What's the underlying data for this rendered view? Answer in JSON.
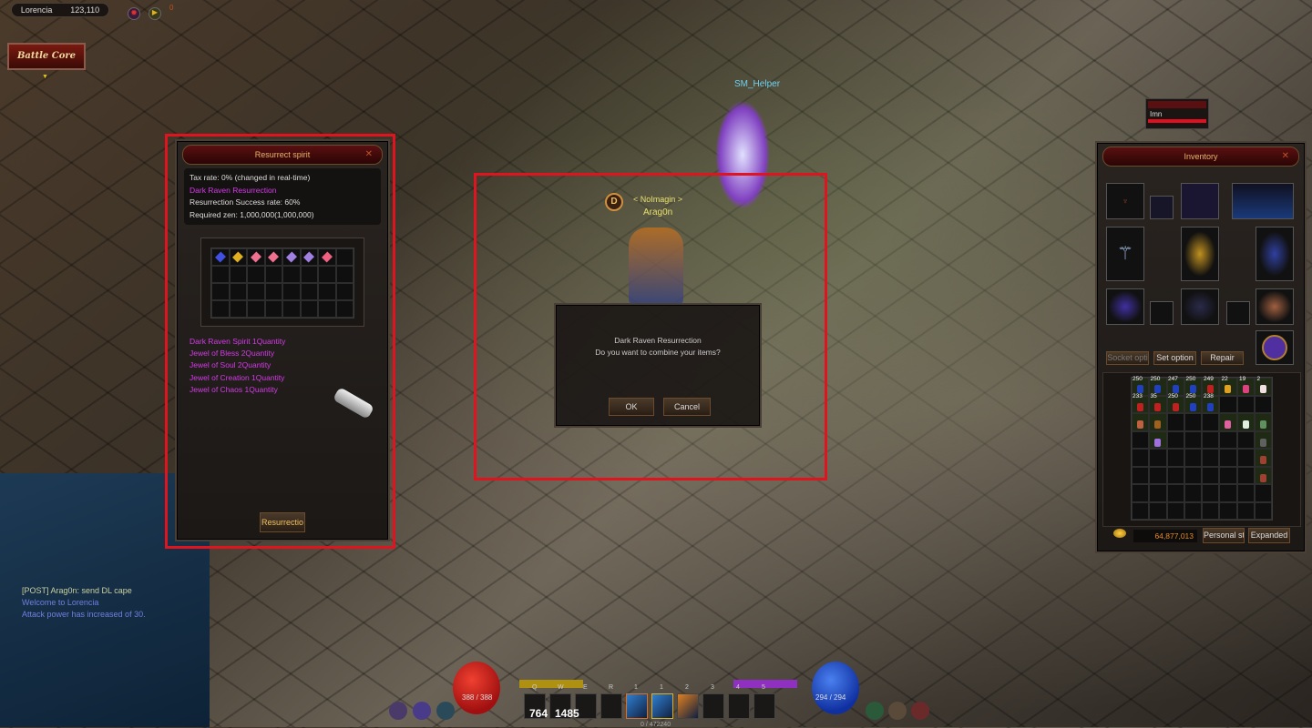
{
  "hud": {
    "location": "Lorencia",
    "coords": "123,110",
    "notification_count": "0",
    "battle_core_label": "Battle Core"
  },
  "resurrect_panel": {
    "title": "Resurrect spirit",
    "tax_rate": "Tax rate: 0% (changed in real-time)",
    "recipe_name": "Dark Raven Resurrection",
    "success_rate": "Resurrection Success rate: 60%",
    "required_zen": "Required zen: 1,000,000(1,000,000)",
    "requirements": [
      "Dark Raven Spirit 1Quantity",
      "Jewel of Bless 2Quantity",
      "Jewel of Soul 2Quantity",
      "Jewel of Creation 1Quantity",
      "Jewel of Chaos 1Quantity"
    ],
    "action_button": "Resurrectio",
    "slot_items": [
      "potion-icon",
      "candle-icon",
      "jewel-bless-icon",
      "jewel-bless-icon",
      "jewel-soul-icon",
      "jewel-soul-icon",
      "jewel-creation-icon"
    ]
  },
  "confirm_dialog": {
    "title": "Dark Raven Resurrection",
    "message": "Do you want to combine your items?",
    "ok": "OK",
    "cancel": "Cancel"
  },
  "character": {
    "guild_tag": "< NoImagin >",
    "name": "Arag0n",
    "helper_name": "SM_Helper"
  },
  "pet": {
    "name": "Imn"
  },
  "inventory": {
    "title": "Inventory",
    "buttons": {
      "socket": "Socket opti",
      "set": "Set option",
      "repair": "Repair",
      "personal_store": "Personal st",
      "expanded": "Expanded"
    },
    "zen": "64,877,013",
    "stack_counts_row1": [
      "250",
      "250",
      "247",
      "250",
      "249",
      "22",
      "19",
      "2"
    ],
    "stack_counts_row2": [
      "233",
      "35",
      "250",
      "250",
      "238"
    ]
  },
  "chat": {
    "lines": [
      {
        "text": "[POST] Arag0n: send DL cape",
        "color": "#c8d0a0"
      },
      {
        "text": "Welcome to Lorencia",
        "color": "#6f7fe0"
      },
      {
        "text": "Attack power has increased of 30.",
        "color": "#6f7fe0"
      }
    ]
  },
  "bottom_bar": {
    "hp": "388 / 388",
    "mp": "294 / 294",
    "hotkeys": [
      "Q",
      "W",
      "E",
      "R"
    ],
    "q_count": "764",
    "w_count": "1485",
    "skill_slots": [
      "1",
      "1",
      "2",
      "3",
      "4",
      "5"
    ],
    "experience": "0 / 472240"
  },
  "colors": {
    "highlight": "#e0141e",
    "magenta_text": "#d43be8",
    "hp": "#c0201a",
    "mp": "#2050c0",
    "zen": "#e08a30"
  }
}
